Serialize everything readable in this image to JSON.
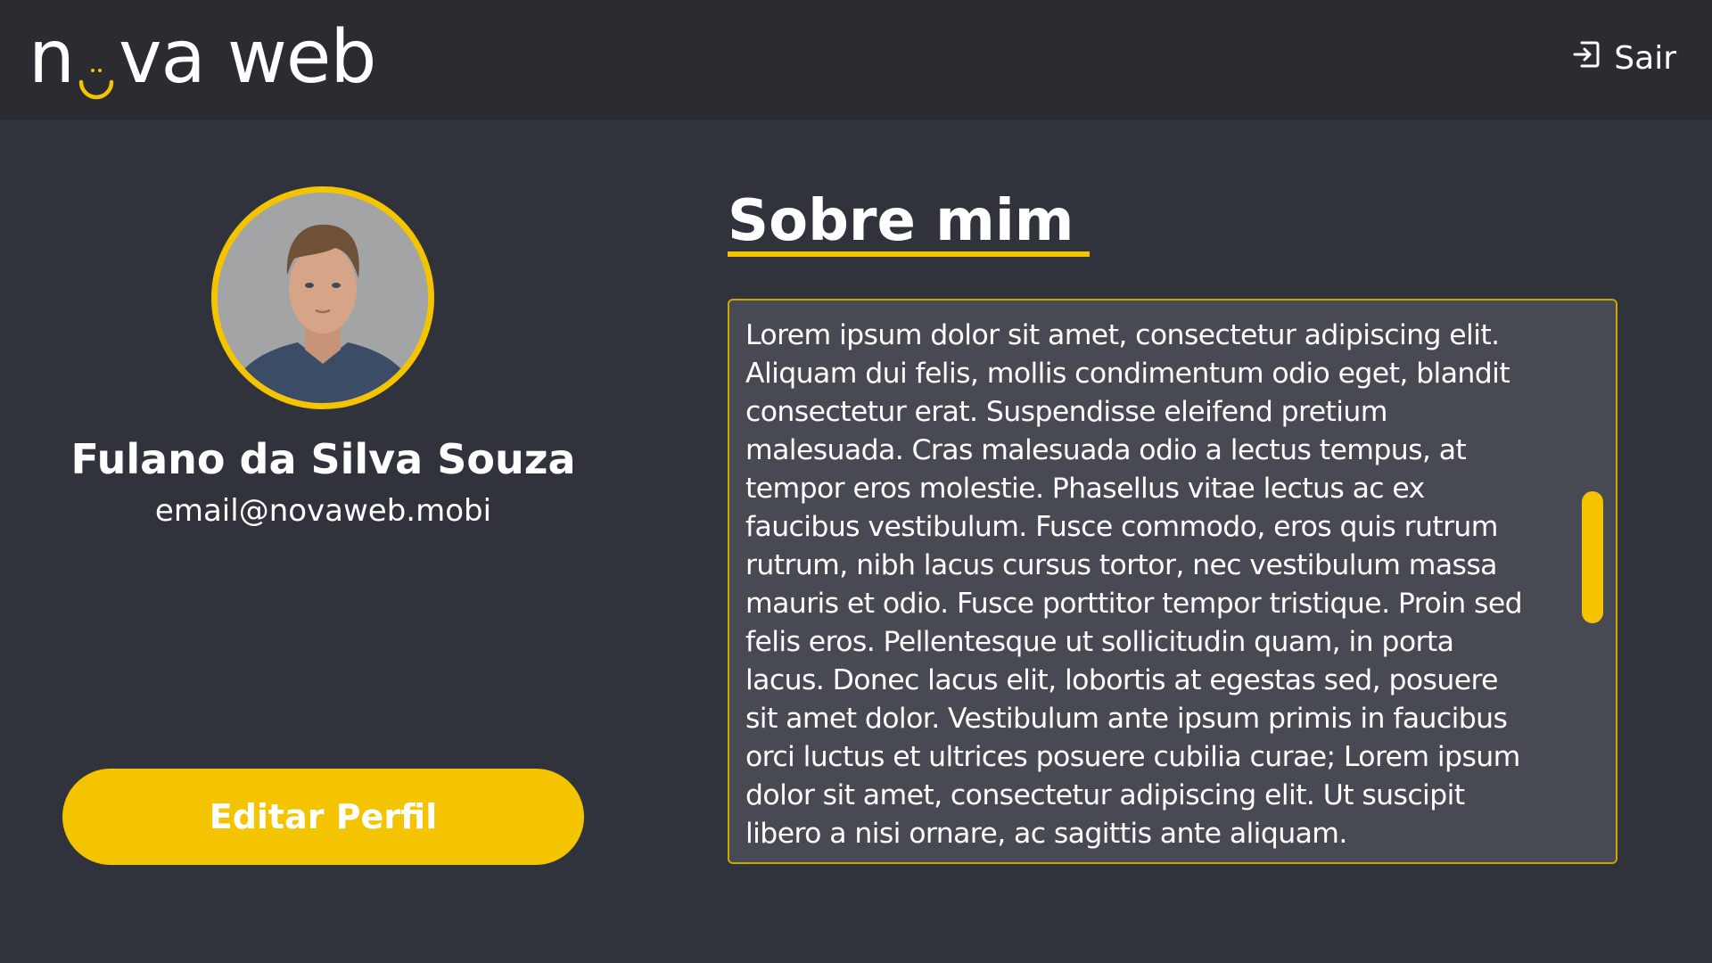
{
  "header": {
    "logo_left": "n",
    "logo_right": "va web",
    "logout_label": "Sair",
    "logout_icon": "logout-icon"
  },
  "profile": {
    "name": "Fulano da Silva Souza",
    "email": "email@novaweb.mobi",
    "edit_button": "Editar Perfil"
  },
  "about": {
    "title": "Sobre mim",
    "text": "Lorem ipsum dolor sit amet, consectetur adipiscing elit. Aliquam dui felis, mollis condimentum odio eget, blandit consectetur erat. Suspendisse eleifend pretium malesuada. Cras malesuada odio a lectus tempus, at tempor eros molestie. Phasellus vitae lectus ac ex faucibus vestibulum. Fusce commodo, eros quis rutrum rutrum, nibh lacus cursus tortor, nec vestibulum massa mauris et odio. Fusce porttitor tempor tristique. Proin sed felis eros. Pellentesque ut sollicitudin quam, in porta lacus. Donec lacus elit, lobortis at egestas sed, posuere sit amet dolor. Vestibulum ante ipsum primis in faucibus orci luctus et ultrices posuere cubilia curae; Lorem ipsum dolor sit amet, consectetur adipiscing elit. Ut suscipit libero a nisi ornare, ac sagittis ante aliquam."
  },
  "colors": {
    "accent": "#f5c400",
    "header_bg": "#2a2c31",
    "page_bg": "#30333b",
    "box_bg": "#474a53"
  }
}
